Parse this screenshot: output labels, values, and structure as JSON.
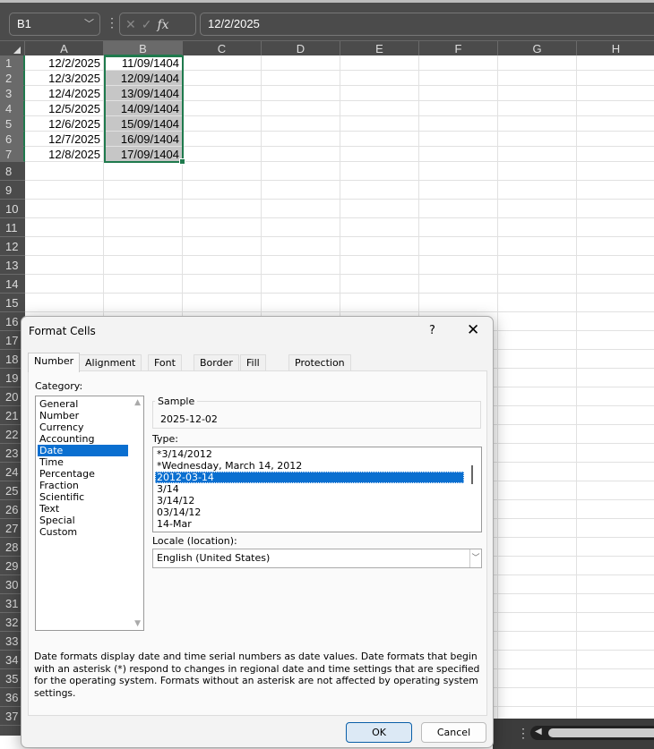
{
  "formula_bar": {
    "name_box": "B1",
    "fx_label": "fx",
    "value": "12/2/2025"
  },
  "columns": [
    "A",
    "B",
    "C",
    "D",
    "E",
    "F",
    "G",
    "H"
  ],
  "selected_column": "B",
  "rows": [
    "1",
    "2",
    "3",
    "4",
    "5",
    "6",
    "7",
    "8",
    "9",
    "10",
    "11",
    "12",
    "13",
    "14",
    "15",
    "16",
    "17",
    "18",
    "19",
    "20",
    "21",
    "22",
    "23",
    "24",
    "25",
    "26",
    "27",
    "28",
    "29",
    "30",
    "31",
    "32",
    "33",
    "34",
    "35",
    "36",
    "37"
  ],
  "cells": {
    "A": [
      "12/2/2025",
      "12/3/2025",
      "12/4/2025",
      "12/5/2025",
      "12/6/2025",
      "12/7/2025",
      "12/8/2025"
    ],
    "B": [
      "11/09/1404",
      "12/09/1404",
      "13/09/1404",
      "14/09/1404",
      "15/09/1404",
      "16/09/1404",
      "17/09/1404"
    ]
  },
  "dialog": {
    "title": "Format Cells",
    "help": "?",
    "close": "✕",
    "tabs": [
      "Number",
      "Alignment",
      "Font",
      "Border",
      "Fill",
      "Protection"
    ],
    "active_tab": "Number",
    "category_label": "Category:",
    "categories": [
      "General",
      "Number",
      "Currency",
      "Accounting",
      "Date",
      "Time",
      "Percentage",
      "Fraction",
      "Scientific",
      "Text",
      "Special",
      "Custom"
    ],
    "selected_category": "Date",
    "sample_label": "Sample",
    "sample_value": "2025-12-02",
    "type_label": "Type:",
    "types": [
      "*3/14/2012",
      "*Wednesday, March 14, 2012",
      "2012-03-14",
      "3/14",
      "3/14/12",
      "03/14/12",
      "14-Mar"
    ],
    "selected_type": "2012-03-14",
    "locale_label": "Locale (location):",
    "locale_value": "English (United States)",
    "description": "Date formats display date and time serial numbers as date values.  Date formats that begin with an asterisk (*) respond to changes in regional date and time settings that are specified for the operating system. Formats without an asterisk are not affected by operating system settings.",
    "ok": "OK",
    "cancel": "Cancel"
  },
  "colors": {
    "selection_border": "#1f7a4d",
    "highlight": "#0a6fd0",
    "chrome": "#4b4b4b"
  }
}
